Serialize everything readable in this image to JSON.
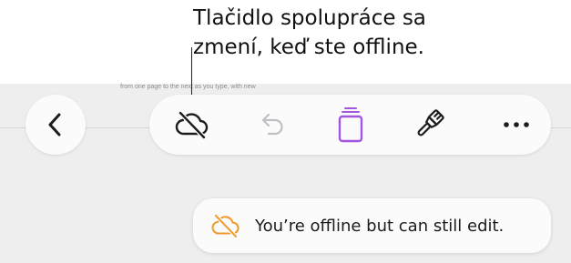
{
  "callout": {
    "line1": "Tlačidlo spolupráce sa",
    "line2": "zmení, keď ste offline."
  },
  "document": {
    "ghost_text": "from one page to the next as you type, with new"
  },
  "toolbar": {
    "back_icon": "chevron-left-icon",
    "collaboration_icon": "cloud-slash-icon",
    "undo_icon": "undo-arrow-icon",
    "pages_icon": "page-stack-icon",
    "format_icon": "paintbrush-icon",
    "more_icon": "ellipsis-icon",
    "accent_color": "#a455e0"
  },
  "toast": {
    "icon": "cloud-slash-icon",
    "icon_color": "#f09a2c",
    "text": "You’re offline but can still edit."
  }
}
